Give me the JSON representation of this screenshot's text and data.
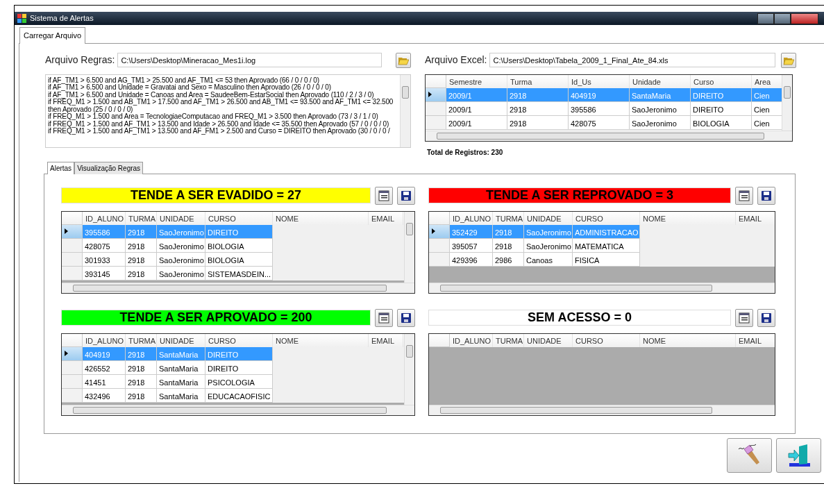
{
  "window": {
    "title": "Sistema de Alertas"
  },
  "tabs": [
    {
      "label": "Carregar Arquivo",
      "selected": true
    }
  ],
  "rules_file": {
    "label": "Arquivo Regras:",
    "value": "C:\\Users\\Desktop\\Mineracao_Mes1i.log"
  },
  "rules": [
    "if AF_TM1 > 6.500 and AG_TM1 > 25.500 and AF_TM1 <= 53 then Aprovado  (66 / 0 / 0 / 0)",
    "if AF_TM1 > 6.500 and Unidade = Gravatai and Sexo = Masculino then Aprovado  (26 / 0 / 0 / 0)",
    "if AF_TM1 > 6.500 and Unidade = Canoas and Area = SaudeeBem-EstarSocial then Aprovado  (110 / 2 / 3 / 0)",
    "if FREQ_M1 > 1.500 and AB_TM1 > 17.500 and AF_TM1 > 26.500 and AB_TM1 <= 93.500 and AF_TM1 <= 32.500 then Aprovado  (25 / 0 / 0 / 0)",
    "if FREQ_M1 > 1.500 and Area = TecnologiaeComputacao and FREQ_M1 > 3.500 then Aprovado  (73 / 3 / 1 / 0)",
    "if FREQ_M1 > 1.500 and AF_TM1 > 13.500 and Idade > 26.500 and Idade <= 35.500 then Aprovado  (57 / 0 / 0 / 0)",
    "if FREQ_M1 > 1.500 and AF_TM1 > 13.500 and AF_FM1 > 2.500 and Curso = DIREITO then Aprovado  (30 / 0 / 0 /"
  ],
  "excel_file": {
    "label": "Arquivo Excel:",
    "value": "C:\\Users\\Desktop\\Tabela_2009_1_Final_Ate_84.xls"
  },
  "excel_grid": {
    "columns": [
      "Semestre",
      "Turma",
      "Id_Us",
      "Unidade",
      "Curso",
      "Area"
    ],
    "rows": [
      {
        "cells": [
          "2009/1",
          "2918",
          "404919",
          "SantaMaria",
          "DIREITO",
          "Cien"
        ],
        "selected": true
      },
      {
        "cells": [
          "2009/1",
          "2918",
          "395586",
          "SaoJeronimo",
          "DIREITO",
          "Cien"
        ],
        "selected": false
      },
      {
        "cells": [
          "2009/1",
          "2918",
          "428075",
          "SaoJeronimo",
          "BIOLOGIA",
          "Cien"
        ],
        "selected": false
      }
    ]
  },
  "total": "Total de Registros: 230",
  "inner_tabs": [
    {
      "label": "Alertas",
      "selected": true
    },
    {
      "label": "Visualização Regras",
      "selected": false
    }
  ],
  "alerts": [
    {
      "title": "TENDE A SER EVADIDO = 27",
      "color": "#ffff00",
      "columns": [
        "ID_ALUNO",
        "TURMA",
        "UNIDADE",
        "CURSO",
        "NOME",
        "EMAIL"
      ],
      "rows": [
        {
          "cells": [
            "395586",
            "2918",
            "SaoJeronimo",
            "DIREITO"
          ],
          "selected": true
        },
        {
          "cells": [
            "428075",
            "2918",
            "SaoJeronimo",
            "BIOLOGIA"
          ],
          "selected": false
        },
        {
          "cells": [
            "301933",
            "2918",
            "SaoJeronimo",
            "BIOLOGIA"
          ],
          "selected": false
        },
        {
          "cells": [
            "393145",
            "2918",
            "SaoJeronimo",
            "SISTEMASDEIN..."
          ],
          "selected": false
        }
      ]
    },
    {
      "title": "TENDE A SER REPROVADO = 3",
      "color": "#ff0000",
      "columns": [
        "ID_ALUNO",
        "TURMA",
        "UNIDADE",
        "CURSO",
        "NOME",
        "EMAIL"
      ],
      "rows": [
        {
          "cells": [
            "352429",
            "2918",
            "SaoJeronimo",
            "ADMINISTRACAO"
          ],
          "selected": true
        },
        {
          "cells": [
            "395057",
            "2918",
            "SaoJeronimo",
            "MATEMATICA"
          ],
          "selected": false
        },
        {
          "cells": [
            "429396",
            "2986",
            "Canoas",
            "FISICA"
          ],
          "selected": false
        }
      ]
    },
    {
      "title": "TENDE A SER APROVADO = 200",
      "color": "#00ff00",
      "columns": [
        "ID_ALUNO",
        "TURMA",
        "UNIDADE",
        "CURSO",
        "NOME",
        "EMAIL"
      ],
      "rows": [
        {
          "cells": [
            "404919",
            "2918",
            "SantaMaria",
            "DIREITO"
          ],
          "selected": true
        },
        {
          "cells": [
            "426552",
            "2918",
            "SantaMaria",
            "DIREITO"
          ],
          "selected": false
        },
        {
          "cells": [
            "41451",
            "2918",
            "SantaMaria",
            "PSICOLOGIA"
          ],
          "selected": false
        },
        {
          "cells": [
            "432496",
            "2918",
            "SantaMaria",
            "EDUCACAOFISIC"
          ],
          "selected": false
        }
      ]
    },
    {
      "title": "SEM ACESSO = 0",
      "color": "#ffffff",
      "columns": [
        "ID_ALUNO",
        "TURMA",
        "UNIDADE",
        "CURSO",
        "NOME",
        "EMAIL"
      ]
    }
  ]
}
